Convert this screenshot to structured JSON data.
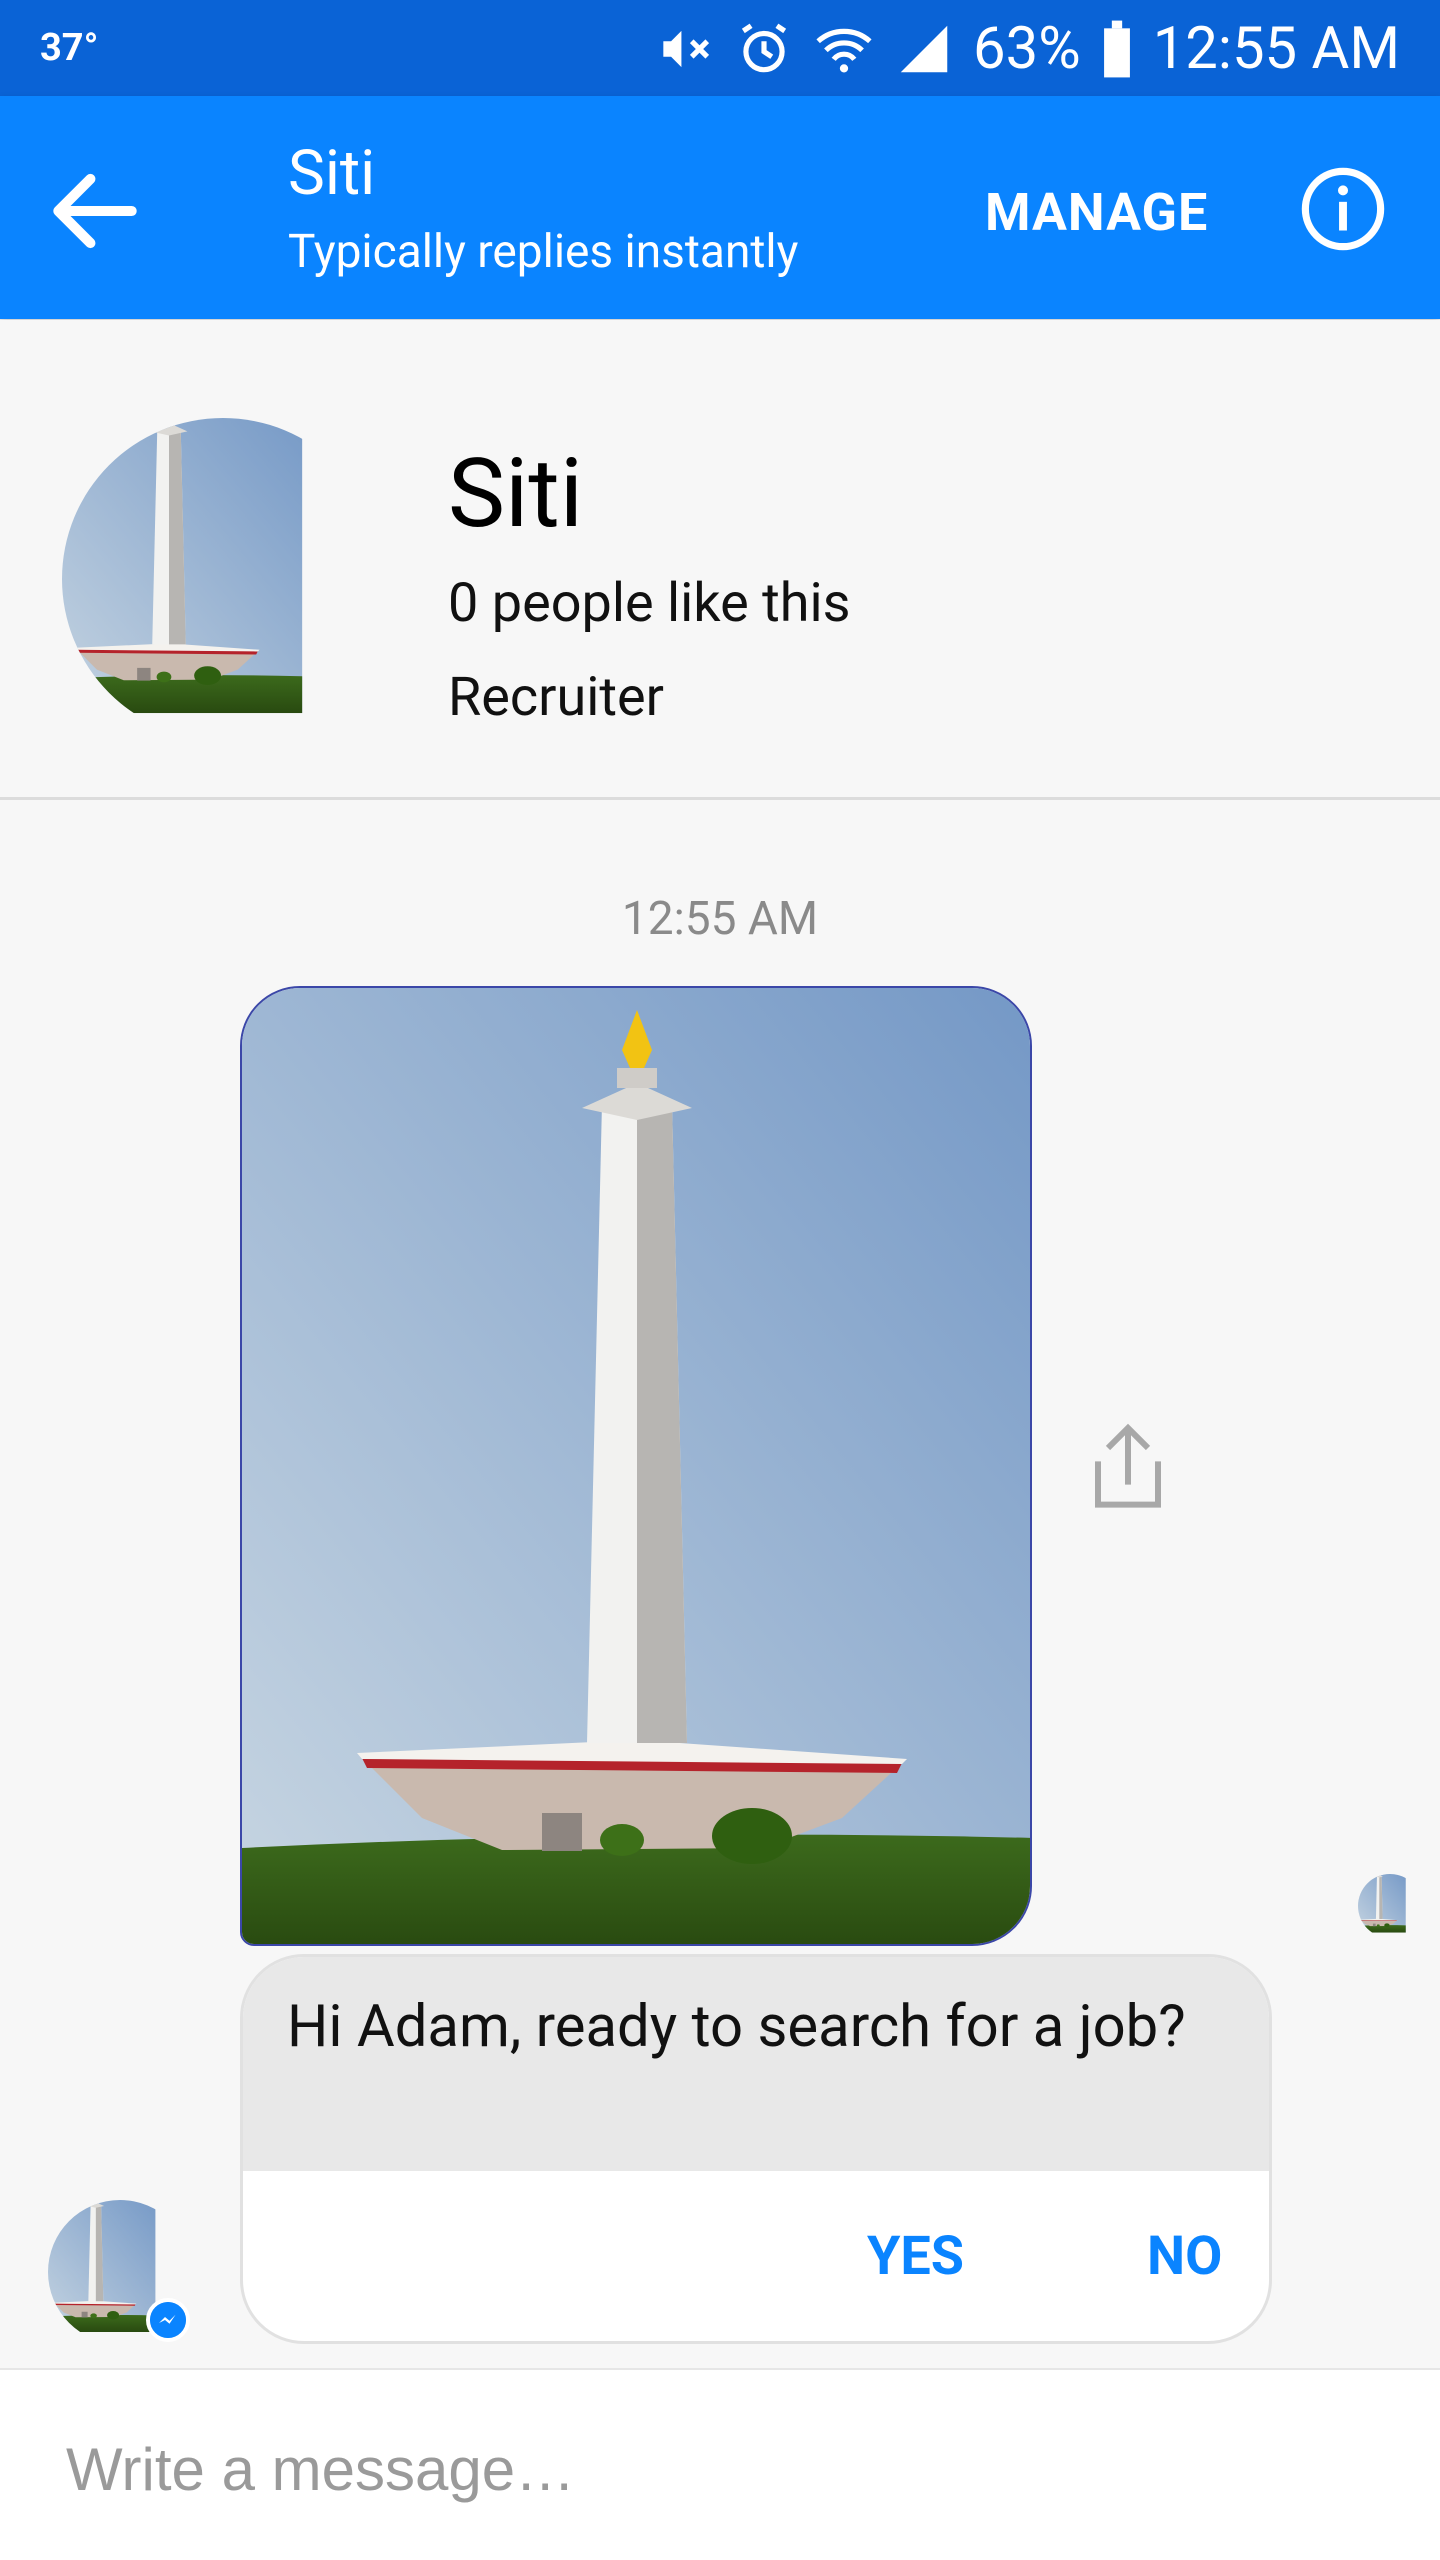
{
  "status_bar": {
    "temperature": "37°",
    "battery": "63%",
    "time": "12:55 AM",
    "icons": [
      "mute-icon",
      "alarm-icon",
      "wifi-icon",
      "signal-icon",
      "battery-icon"
    ]
  },
  "app_bar": {
    "back_icon": "arrow-left-icon",
    "title": "Siti",
    "subtitle": "Typically replies instantly",
    "manage_label": "MANAGE",
    "info_icon": "info-icon"
  },
  "profile": {
    "name": "Siti",
    "likes": "0 people like this",
    "role": "Recruiter"
  },
  "chat": {
    "timestamp": "12:55 AM",
    "share_icon": "share-icon",
    "card": {
      "text": "Hi Adam, ready to search for a job?",
      "replies": [
        "YES",
        "NO"
      ]
    }
  },
  "composer": {
    "placeholder": "Write a message…"
  },
  "colors": {
    "status_bar": "#0a63d6",
    "app_bar": "#0a84ff",
    "accent": "#0a84ff",
    "background": "#f7f7f7"
  }
}
